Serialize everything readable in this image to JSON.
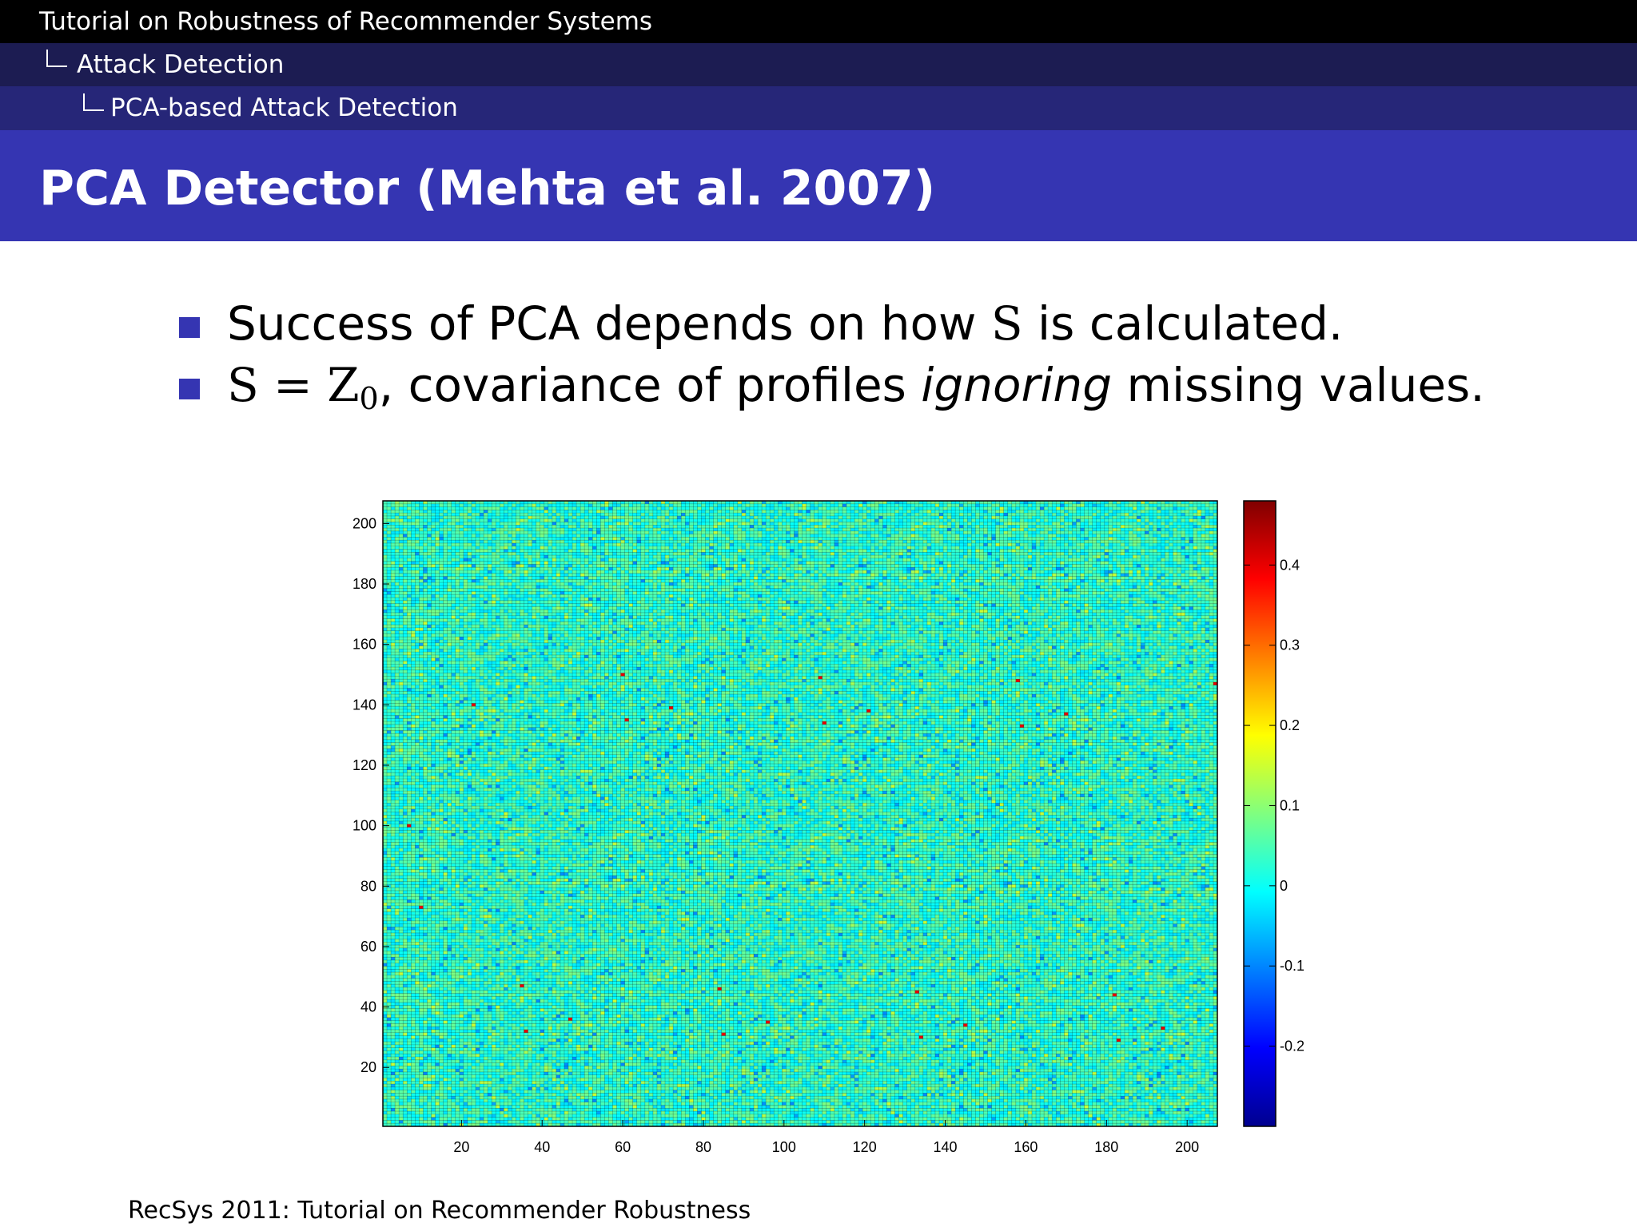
{
  "header": {
    "section": "Tutorial on Robustness of Recommender Systems",
    "subsection": "Attack Detection",
    "subsubsection": "PCA-based Attack Detection"
  },
  "slide": {
    "title": "PCA Detector (Mehta et al. 2007)",
    "bullet1": {
      "before": "Success of PCA depends on how ",
      "math": "S",
      "after": " is calculated."
    },
    "bullet2": {
      "math_a": "S = Z",
      "math_sub": "0",
      "text1": ", covariance of profiles ",
      "emph": "ignoring",
      "text2": " missing values."
    }
  },
  "footer": {
    "text": "RecSys 2011: Tutorial on Recommender Robustness"
  },
  "chart_data": {
    "type": "heatmap",
    "title": "",
    "xlabel": "",
    "ylabel": "",
    "xlim": [
      0.5,
      207.5
    ],
    "ylim": [
      0.5,
      207.5
    ],
    "xticks": [
      20,
      40,
      60,
      80,
      100,
      120,
      140,
      160,
      180,
      200
    ],
    "yticks": [
      20,
      40,
      60,
      80,
      100,
      120,
      140,
      160,
      180,
      200
    ],
    "colorbar": {
      "colormap": "jet",
      "clim": [
        -0.3,
        0.48
      ],
      "ticks": [
        -0.2,
        -0.1,
        0,
        0.1,
        0.2,
        0.3,
        0.4
      ],
      "tick_labels": [
        "-0.2",
        "-0.1",
        "0",
        "0.1",
        "0.2",
        "0.3",
        "0.4"
      ]
    },
    "grid": true,
    "description_values": {
      "typical_min": -0.1,
      "typical_max": 0.15,
      "dominant": 0.03
    }
  }
}
